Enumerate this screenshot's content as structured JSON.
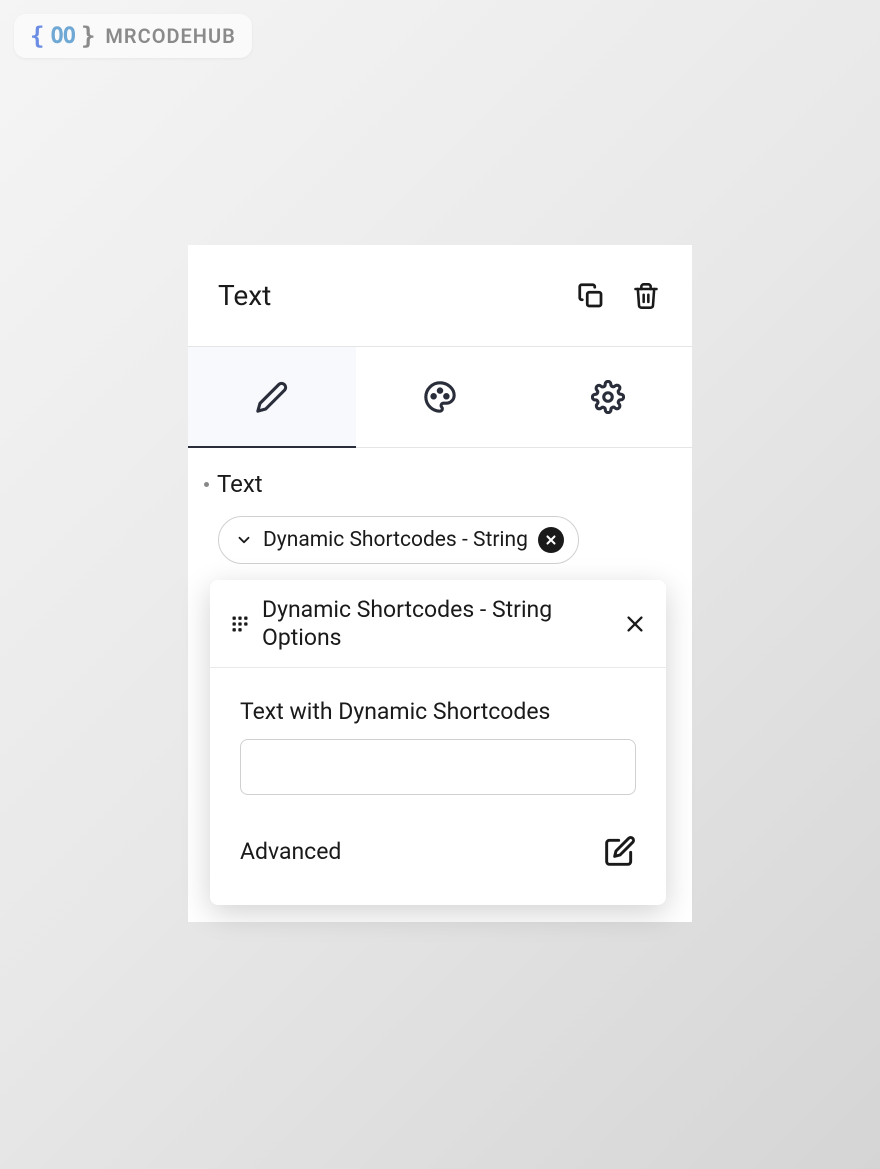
{
  "watermark": {
    "text": "MRCODEHUB"
  },
  "panel": {
    "title": "Text",
    "section_label": "Text",
    "chip_label": "Dynamic Shortcodes - String"
  },
  "popover": {
    "title": "Dynamic Shortcodes - String Options",
    "field_label": "Text with Dynamic Shortcodes",
    "input_value": "",
    "advanced_label": "Advanced"
  }
}
